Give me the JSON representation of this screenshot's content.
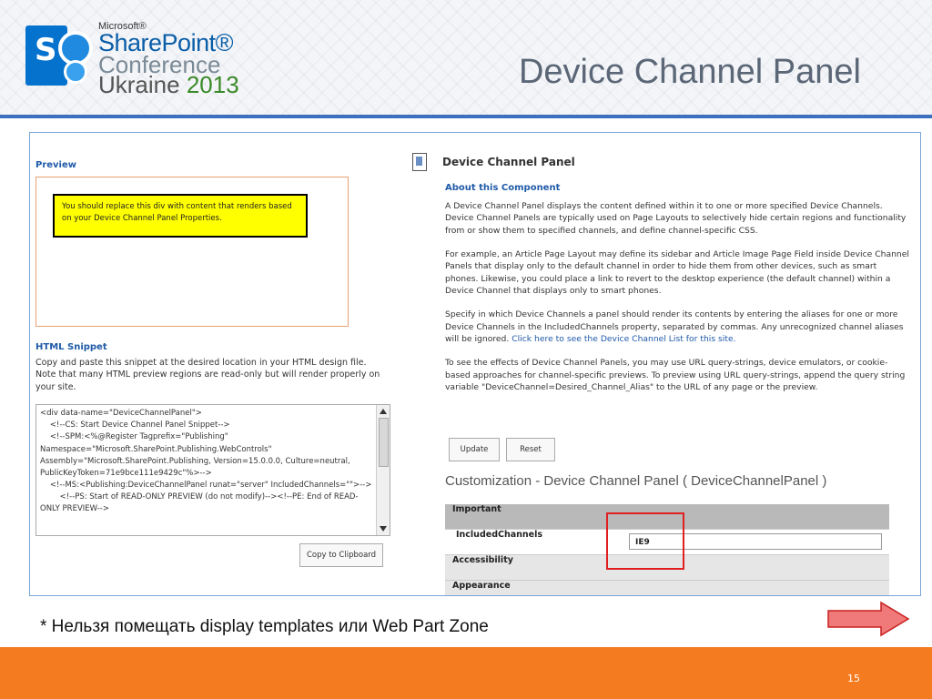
{
  "header": {
    "logo": {
      "microsoft": "Microsoft®",
      "sharepoint": "SharePoint®",
      "conference": "Conference",
      "ukraine": "Ukraine",
      "year": "2013",
      "letter": "S"
    },
    "title": "Device Channel Panel"
  },
  "left": {
    "preview_label": "Preview",
    "preview_text": "You should replace this div with content that renders based on your Device Channel Panel Properties.",
    "snippet_label": "HTML Snippet",
    "snippet_description": "Copy and paste this snippet at the desired location in your HTML design file. Note that many HTML preview regions are read-only but will render properly on your site.",
    "snippet_code": "<div data-name=\"DeviceChannelPanel\">\n    <!--CS: Start Device Channel Panel Snippet-->\n    <!--SPM:<%@Register Tagprefix=\"Publishing\" Namespace=\"Microsoft.SharePoint.Publishing.WebControls\" Assembly=\"Microsoft.SharePoint.Publishing, Version=15.0.0.0, Culture=neutral, PublicKeyToken=71e9bce111e9429c\"%>-->\n    <!--MS:<Publishing:DeviceChannelPanel runat=\"server\" IncludedChannels=\"\">-->\n        <!--PS: Start of READ-ONLY PREVIEW (do not modify)--><!--PE: End of READ-ONLY PREVIEW-->",
    "copy_button": "Copy to Clipboard"
  },
  "right": {
    "panel_title": "Device Channel Panel",
    "about_label": "About this Component",
    "para1": "A Device Channel Panel displays the content defined within it to one or more specified Device Channels. Device Channel Panels are typically used on Page Layouts to selectively hide certain regions and functionality from or show them to specified channels, and define channel-specific CSS.",
    "para2": "For example, an Article Page Layout may define its sidebar and Article Image Page Field inside Device Channel Panels that display only to the default channel in order to hide them from other devices, such as smart phones. Likewise, you could place a link to revert to the desktop experience (the default channel) within a Device Channel that displays only to smart phones.",
    "para3": "Specify in which Device Channels a panel should render its contents by entering the aliases for one or more Device Channels in the IncludedChannels property, separated by commas. Any unrecognized channel aliases will be ignored.",
    "para3_link": "Click here to see the Device Channel List for this site.",
    "para4": "To see the effects of Device Channel Panels, you may use URL query-strings, device emulators, or cookie-based approaches for channel-specific previews. To preview using URL query-strings, append the query string variable \"DeviceChannel=Desired_Channel_Alias\" to the URL of any page or the preview.",
    "update_button": "Update",
    "reset_button": "Reset",
    "customization_title": "Customization - Device Channel Panel ( DeviceChannelPanel )",
    "table": {
      "important": "Important",
      "included_channels_label": "IncludedChannels",
      "included_channels_value": "IE9",
      "accessibility": "Accessibility",
      "appearance": "Appearance"
    }
  },
  "footnote": "* Нельзя помещать display templates или Web Part Zone",
  "page_number": "15",
  "colors": {
    "accent_blue": "#3d6fbf",
    "footer_orange": "#f47b20",
    "highlight_red": "#e02020",
    "preview_yellow": "#ffff00",
    "arrow_fill": "#f07a7a"
  }
}
